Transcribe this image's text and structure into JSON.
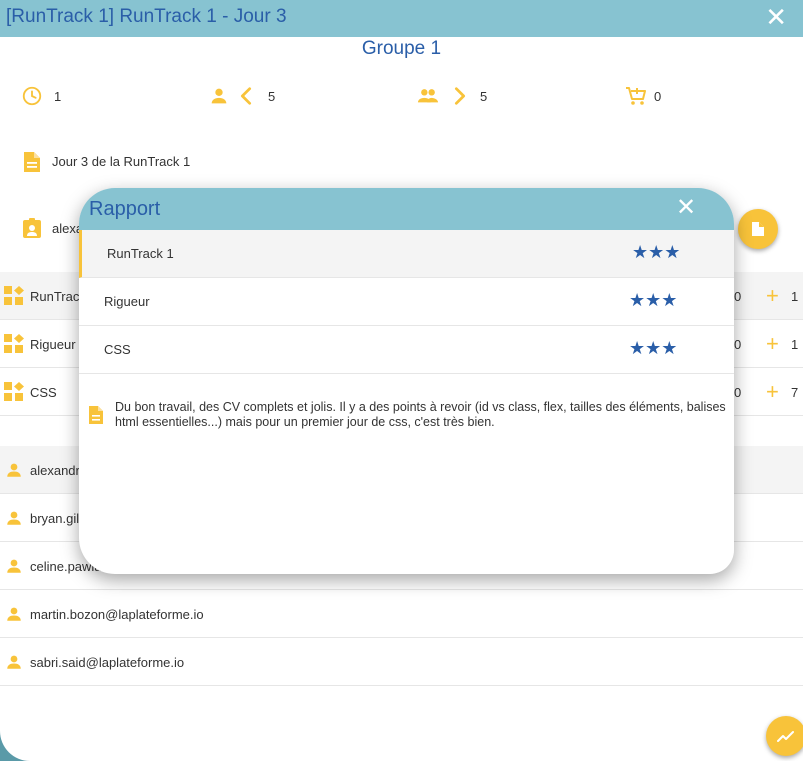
{
  "window": {
    "title": "[RunTrack 1] RunTrack 1 - Jour 3",
    "close_glyph": "✕"
  },
  "group_title": "Groupe 1",
  "stats": [
    {
      "icon": "clock-icon",
      "value": "1"
    },
    {
      "icon": "person-prev-icon",
      "value": "5"
    },
    {
      "icon": "group-next-icon",
      "value": "5"
    },
    {
      "icon": "cart-icon",
      "value": "0"
    }
  ],
  "description": "Jour 3 de la RunTrack 1",
  "owner_partial": "alexa",
  "competences": [
    {
      "label_partial": "RunTrac",
      "count": "0",
      "plus_value": "1"
    },
    {
      "label_partial": "Rigueur",
      "count": "0",
      "plus_value": "1"
    },
    {
      "label_partial": "CSS",
      "count": "0",
      "plus_value": "7"
    }
  ],
  "users": [
    {
      "label": "alexandr"
    },
    {
      "label": "bryan.gil"
    },
    {
      "label": "celine.pawla"
    },
    {
      "label": "martin.bozon@laplateforme.io"
    },
    {
      "label": "sabri.said@laplateforme.io"
    }
  ],
  "modal": {
    "title": "Rapport",
    "close_glyph": "✕",
    "rows": [
      {
        "label": "RunTrack 1",
        "stars": "★★★"
      },
      {
        "label": "Rigueur",
        "stars": "★★★"
      },
      {
        "label": "CSS",
        "stars": "★★★"
      }
    ],
    "comment": "Du bon travail, des CV complets et jolis. Il y a des points à revoir (id vs class, flex, tailles des éléments, balises html essentielles...) mais pour un premier jour de css, c'est très bien."
  },
  "colors": {
    "accent": "#f8c33a",
    "header": "#87c3d1",
    "title_blue": "#2a5ea8"
  }
}
